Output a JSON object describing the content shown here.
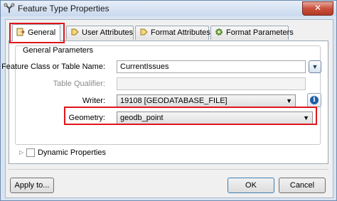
{
  "window": {
    "title": "Feature Type Properties",
    "close_glyph": "✕"
  },
  "tabs": [
    {
      "label": "General",
      "icon": "general-tab-icon",
      "active": true
    },
    {
      "label": "User Attributes",
      "icon": "arrow-tag-icon",
      "active": false
    },
    {
      "label": "Format Attributes",
      "icon": "arrow-tag-icon",
      "active": false
    },
    {
      "label": "Format Parameters",
      "icon": "gear-icon",
      "active": false
    }
  ],
  "general_parameters": {
    "title": "General Parameters",
    "feature_class_label": "Feature Class or Table Name:",
    "feature_class_value": "CurrentIssues",
    "table_qualifier_label": "Table Qualifier:",
    "table_qualifier_value": "",
    "writer_label": "Writer:",
    "writer_value": "19108 [GEODATABASE_FILE]",
    "geometry_label": "Geometry:",
    "geometry_value": "geodb_point"
  },
  "dynamic_properties": {
    "label": "Dynamic Properties",
    "checked": false
  },
  "buttons": {
    "apply": "Apply to...",
    "ok": "OK",
    "cancel": "Cancel"
  },
  "colors": {
    "highlight": "#e0141b",
    "info_blue": "#1f5fa8"
  }
}
